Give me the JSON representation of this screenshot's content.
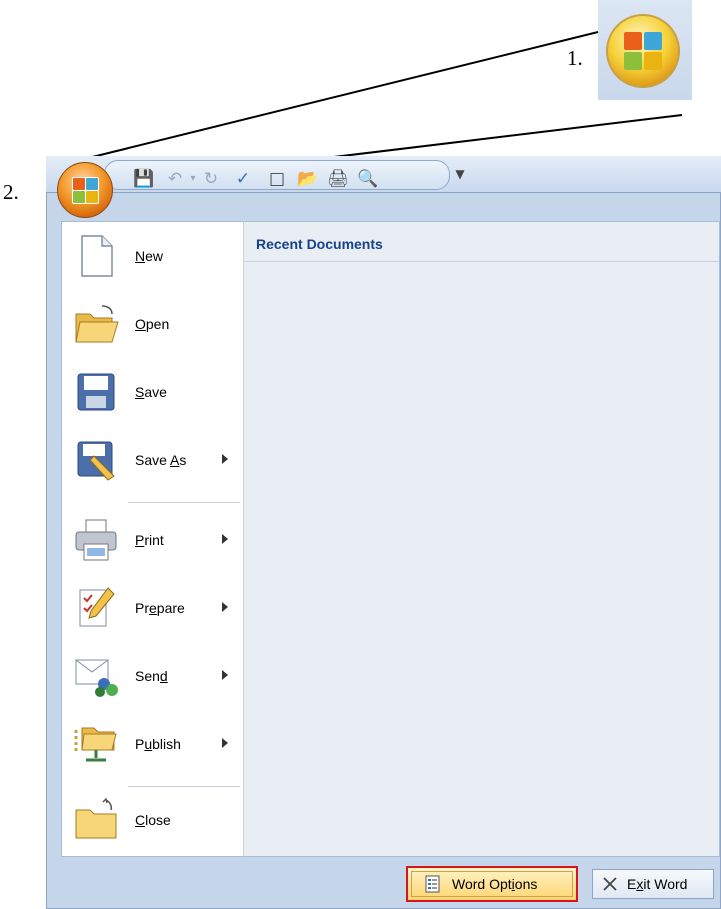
{
  "steps": {
    "step1": "1.",
    "step2": "2."
  },
  "menu": {
    "recent_header": "Recent Documents",
    "items": [
      {
        "pre": "",
        "key": "N",
        "post": "ew",
        "arrow": false,
        "icon": "new-document-icon"
      },
      {
        "pre": "",
        "key": "O",
        "post": "pen",
        "arrow": false,
        "icon": "open-folder-icon"
      },
      {
        "pre": "",
        "key": "S",
        "post": "ave",
        "arrow": false,
        "icon": "save-disk-icon"
      },
      {
        "pre": "Save ",
        "key": "A",
        "post": "s",
        "arrow": true,
        "icon": "save-as-icon"
      },
      {
        "pre": "",
        "key": "P",
        "post": "rint",
        "arrow": true,
        "icon": "printer-icon"
      },
      {
        "pre": "Pr",
        "key": "e",
        "post": "pare",
        "arrow": true,
        "icon": "prepare-icon"
      },
      {
        "pre": "Sen",
        "key": "d",
        "post": "",
        "arrow": true,
        "icon": "send-icon"
      },
      {
        "pre": "P",
        "key": "u",
        "post": "blish",
        "arrow": true,
        "icon": "publish-icon"
      },
      {
        "pre": "",
        "key": "C",
        "post": "lose",
        "arrow": false,
        "icon": "close-folder-icon"
      }
    ]
  },
  "buttons": {
    "word_options": {
      "pre": "Word Opt",
      "key": "i",
      "post": "ons"
    },
    "exit_word": {
      "pre": "E",
      "key": "x",
      "post": "it Word"
    }
  },
  "colors": {
    "highlight_border": "#d6161d",
    "header_text": "#15428b"
  }
}
